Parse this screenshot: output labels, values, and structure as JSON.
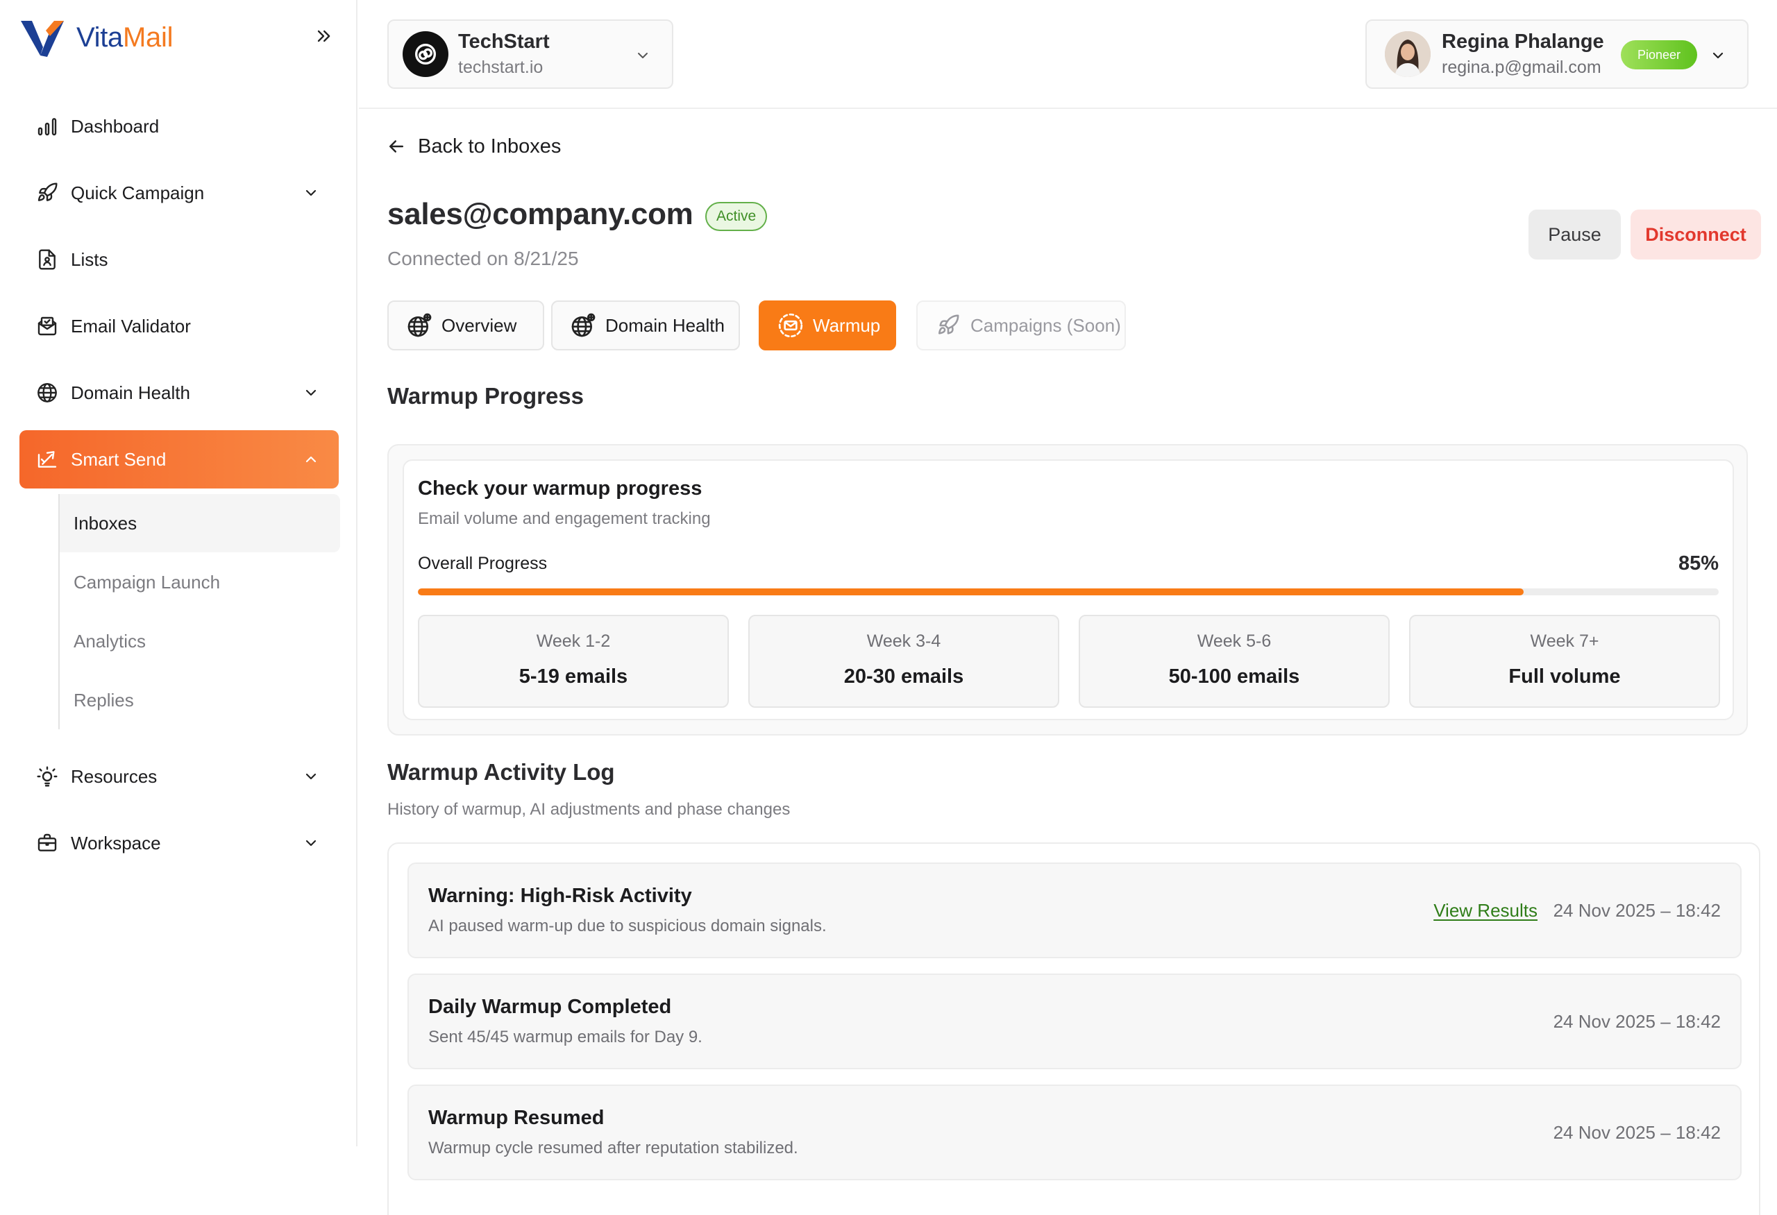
{
  "brand": {
    "name_part1": "Vita",
    "name_part2": "Mail",
    "accent": "#f47a20",
    "primary": "#1c3f94"
  },
  "sidebar": {
    "items": [
      {
        "label": "Dashboard",
        "icon": "bar-chart-icon"
      },
      {
        "label": "Quick Campaign",
        "icon": "rocket-icon"
      },
      {
        "label": "Lists",
        "icon": "contact-file-icon"
      },
      {
        "label": "Email Validator",
        "icon": "mail-check-icon"
      },
      {
        "label": "Domain Health",
        "icon": "globe-icon"
      },
      {
        "label": "Smart Send",
        "icon": "smart-send-icon"
      },
      {
        "label": "Resources",
        "icon": "lightbulb-icon"
      },
      {
        "label": "Workspace",
        "icon": "briefcase-icon"
      }
    ],
    "smart_send_subitems": [
      {
        "label": "Inboxes"
      },
      {
        "label": "Campaign Launch"
      },
      {
        "label": "Analytics"
      },
      {
        "label": "Replies"
      }
    ]
  },
  "org": {
    "name": "TechStart",
    "domain": "techstart.io"
  },
  "user": {
    "name": "Regina Phalange",
    "email": "regina.p@gmail.com",
    "badge": "Pioneer"
  },
  "main": {
    "back_label": "Back to Inboxes",
    "inbox_email": "sales@company.com",
    "status": "Active",
    "connected": "Connected on 8/21/25",
    "pause_label": "Pause",
    "disconnect_label": "Disconnect",
    "tabs": [
      {
        "label": "Overview",
        "icon": "globe-plus-icon"
      },
      {
        "label": "Domain Health",
        "icon": "globe-plus-icon"
      },
      {
        "label": "Warmup",
        "icon": "warmup-mail-icon"
      },
      {
        "label": "Campaigns (Soon)",
        "icon": "rocket-icon"
      }
    ]
  },
  "warmup": {
    "section_title": "Warmup Progress",
    "card_title": "Check your warmup progress",
    "card_subtitle": "Email volume and engagement tracking",
    "overall_label": "Overall Progress",
    "overall_percent_text": "85%",
    "overall_fraction": 0.85,
    "weeks": [
      {
        "label": "Week 1-2",
        "value": "5-19 emails"
      },
      {
        "label": "Week 3-4",
        "value": "20-30 emails"
      },
      {
        "label": "Week 5-6",
        "value": "50-100 emails"
      },
      {
        "label": "Week 7+",
        "value": "Full volume"
      }
    ]
  },
  "activity_log": {
    "title": "Warmup Activity Log",
    "subtitle": "History of warmup, AI adjustments and phase changes",
    "entries": [
      {
        "title": "Warning: High-Risk Activity",
        "description": "AI paused warm-up due to suspicious domain signals.",
        "link": "View Results",
        "time": "24 Nov 2025 – 18:42"
      },
      {
        "title": "Daily Warmup Completed",
        "description": "Sent 45/45 warmup emails for Day 9.",
        "time": "24 Nov 2025 – 18:42"
      },
      {
        "title": "Warmup Resumed",
        "description": "Warmup cycle resumed after reputation stabilized.",
        "time": "24 Nov 2025 – 18:42"
      }
    ]
  }
}
